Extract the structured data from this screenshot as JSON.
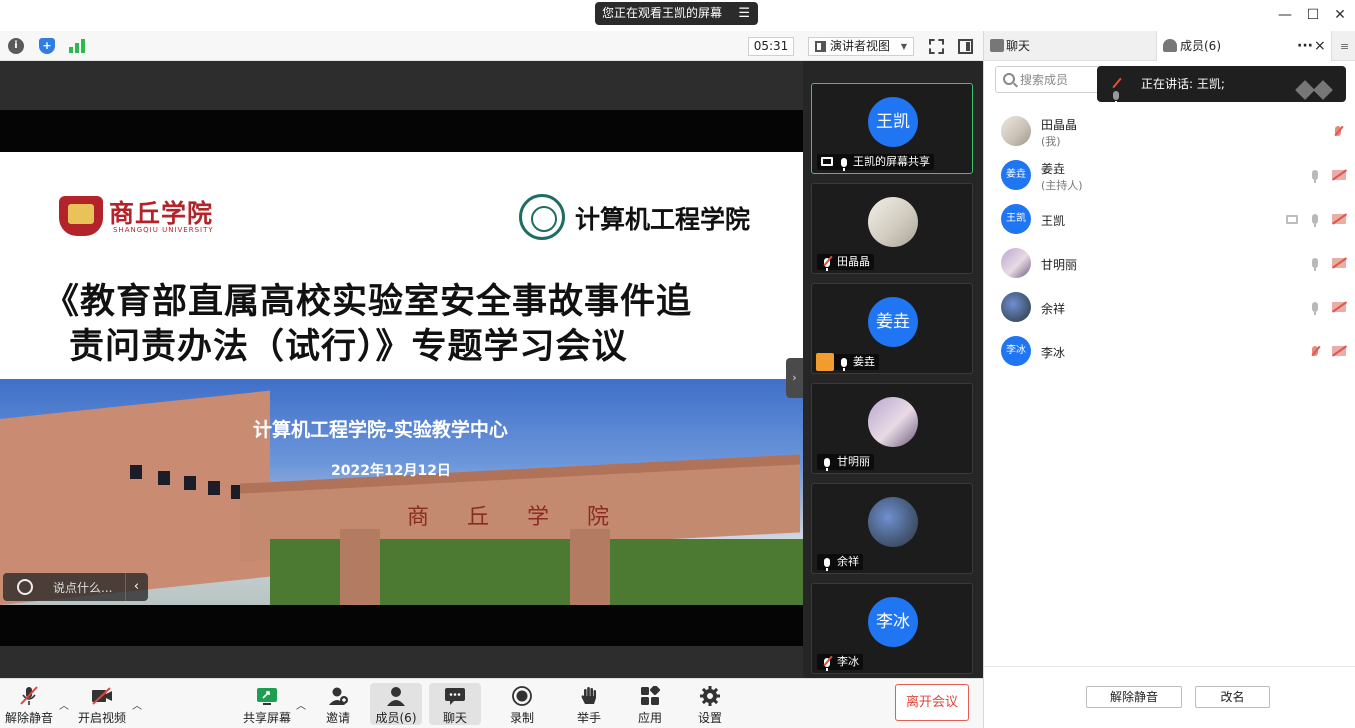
{
  "window": {
    "share_banner": "您正在观看王凯的屏幕",
    "banner_menu_icon": "menu-icon"
  },
  "toolbar": {
    "timer": "05:31",
    "view_mode": "演讲者视图",
    "icons": [
      "info-icon",
      "shield-icon",
      "signal-icon",
      "fullscreen-icon",
      "sidebar-toggle-icon"
    ]
  },
  "slide": {
    "univ_name_cn": "商丘学院",
    "univ_name_en": "SHANGQIU UNIVERSITY",
    "college_name": "计算机工程学院",
    "title_line1": "《教育部直属高校实验室安全事故事件追",
    "title_line2": "责问责办法（试行）》专题学习会议",
    "subtitle": "计算机工程学院-实验教学中心",
    "date": "2022年12月12日",
    "gate_text": "商丘学院"
  },
  "comment": {
    "placeholder": "说点什么..."
  },
  "gallery": [
    {
      "name": "王凯的屏幕共享",
      "initials": "王凯",
      "type": "initials",
      "mic": "on",
      "screen": true,
      "active": true
    },
    {
      "name": "田晶晶",
      "initials": "",
      "type": "photo1",
      "mic": "off"
    },
    {
      "name": "姜垚",
      "initials": "姜垚",
      "type": "initials",
      "mic": "on",
      "host": true
    },
    {
      "name": "甘明丽",
      "initials": "",
      "type": "photo2",
      "mic": "on"
    },
    {
      "name": "余祥",
      "initials": "",
      "type": "photo3",
      "mic": "on"
    },
    {
      "name": "李冰",
      "initials": "李冰",
      "type": "initials",
      "mic": "off"
    }
  ],
  "bottombar": {
    "unmute": "解除静音",
    "start_video": "开启视频",
    "share_screen": "共享屏幕",
    "invite": "邀请",
    "members": "成员(6)",
    "chat": "聊天",
    "record": "录制",
    "raise_hand": "举手",
    "apps": "应用",
    "settings": "设置",
    "leave": "离开会议"
  },
  "right_panel": {
    "tab_chat": "聊天",
    "tab_members": "成员(6)",
    "more": "···",
    "close": "×",
    "search_placeholder": "搜索成员",
    "speaking": "正在讲话: 王凯;",
    "members": [
      {
        "name": "田晶晶",
        "role": "(我)",
        "avatar": "",
        "type": "p1"
      },
      {
        "name": "姜垚",
        "role": "(主持人)",
        "avatar": "姜垚",
        "type": "initials"
      },
      {
        "name": "王凯",
        "role": "",
        "avatar": "王凯",
        "type": "initials"
      },
      {
        "name": "甘明丽",
        "role": "",
        "avatar": "",
        "type": "p2"
      },
      {
        "name": "余祥",
        "role": "",
        "avatar": "",
        "type": "p3"
      },
      {
        "name": "李冰",
        "role": "",
        "avatar": "李冰",
        "type": "initials"
      }
    ],
    "unmute_all": "解除静音",
    "rename": "改名"
  },
  "colors": {
    "accent_blue": "#1f75f2",
    "active_green": "#3bc46a",
    "leave_red": "#e0463b"
  }
}
